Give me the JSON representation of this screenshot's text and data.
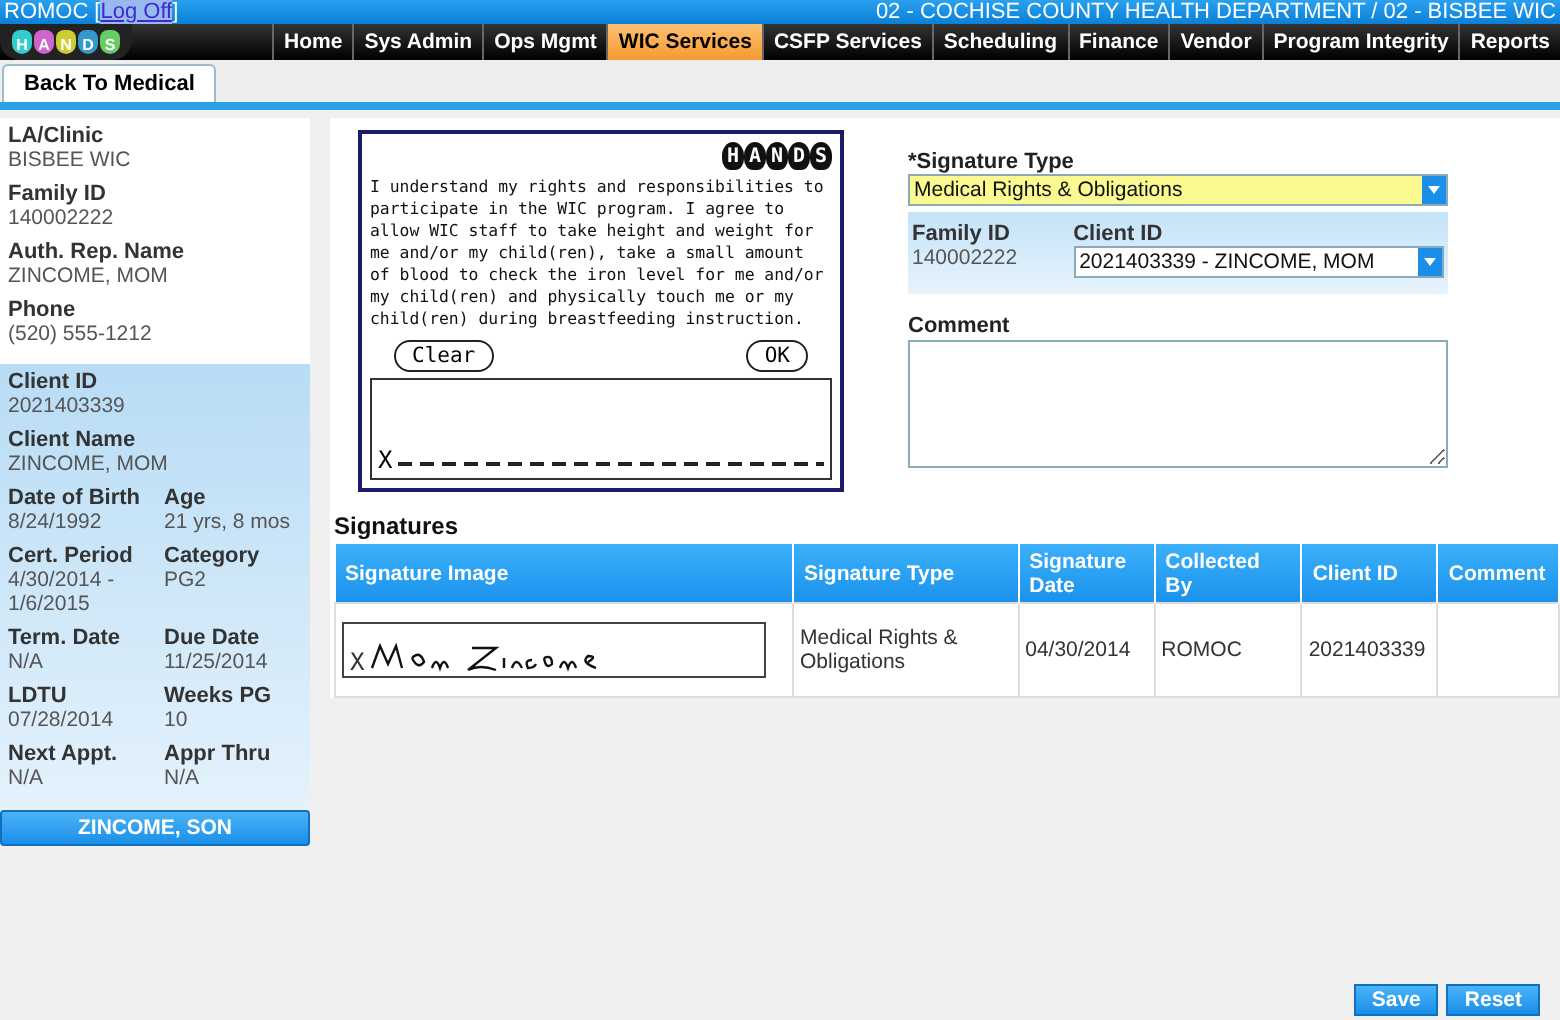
{
  "header": {
    "user": "ROMOC",
    "log_off": "Log Off",
    "brackets": [
      "[",
      "]"
    ],
    "agency": "02 - COCHISE COUNTY HEALTH DEPARTMENT / 02 - BISBEE WIC",
    "logo_letters": [
      "H",
      "A",
      "N",
      "D",
      "S"
    ]
  },
  "nav": [
    {
      "label": "Home",
      "selected": false
    },
    {
      "label": "Sys Admin",
      "selected": false
    },
    {
      "label": "Ops Mgmt",
      "selected": false
    },
    {
      "label": "WIC Services",
      "selected": true
    },
    {
      "label": "CSFP Services",
      "selected": false
    },
    {
      "label": "Scheduling",
      "selected": false
    },
    {
      "label": "Finance",
      "selected": false
    },
    {
      "label": "Vendor",
      "selected": false
    },
    {
      "label": "Program Integrity",
      "selected": false
    },
    {
      "label": "Reports",
      "selected": false
    }
  ],
  "toolbar": {
    "back_button": "Back To Medical"
  },
  "sidebar": {
    "family_fields": [
      {
        "label": "LA/Clinic",
        "value": "BISBEE WIC"
      },
      {
        "label": "Family ID",
        "value": "140002222"
      },
      {
        "label": "Auth. Rep. Name",
        "value": "ZINCOME, MOM"
      },
      {
        "label": "Phone",
        "value": "(520) 555-1212"
      }
    ],
    "client_fields": [
      {
        "label": "Client ID",
        "value": "2021403339"
      },
      {
        "label": "Client Name",
        "value": "ZINCOME, MOM"
      }
    ],
    "client_grid": [
      {
        "label": "Date of Birth",
        "value": "8/24/1992"
      },
      {
        "label": "Age",
        "value": "21 yrs, 8 mos"
      },
      {
        "label": "Cert. Period",
        "value": "4/30/2014 - 1/6/2015"
      },
      {
        "label": "Category",
        "value": "PG2"
      },
      {
        "label": "Term. Date",
        "value": "N/A"
      },
      {
        "label": "Due Date",
        "value": "11/25/2014"
      },
      {
        "label": "LDTU",
        "value": "07/28/2014"
      },
      {
        "label": "Weeks PG",
        "value": "10"
      },
      {
        "label": "Next Appt.",
        "value": "N/A"
      },
      {
        "label": "Appr Thru",
        "value": "N/A"
      }
    ],
    "other_client": "ZINCOME, SON"
  },
  "signature_pad": {
    "logo_letters": [
      "H",
      "A",
      "N",
      "D",
      "S"
    ],
    "statement": "I understand my rights and responsibilities to participate in the WIC program.  I agree to allow WIC staff to take height and weight for me and/or my child(ren), take a small amount of blood to check the iron level for me and/or my child(ren) and physically touch me or my child(ren) during breastfeeding instruction.",
    "clear_button": "Clear",
    "ok_button": "OK",
    "sign_mark": "X"
  },
  "form": {
    "signature_type_label": "*Signature Type",
    "signature_type_value": "Medical Rights & Obligations",
    "family_id_label": "Family ID",
    "family_id": "140002222",
    "client_id_label": "Client ID",
    "client_id_value": "2021403339 - ZINCOME, MOM",
    "comment_label": "Comment"
  },
  "signatures": {
    "title": "Signatures",
    "columns": [
      "Signature Image",
      "Signature Type",
      "Signature Date",
      "Collected By",
      "Client ID",
      "Comment"
    ],
    "rows": [
      {
        "sign_mark": "X",
        "signature_type": "Medical Rights & Obligations",
        "signature_date": "04/30/2014",
        "collected_by": "ROMOC",
        "client_id": "2021403339"
      }
    ]
  },
  "footer": {
    "buttons": [
      "Save",
      "Reset"
    ]
  }
}
